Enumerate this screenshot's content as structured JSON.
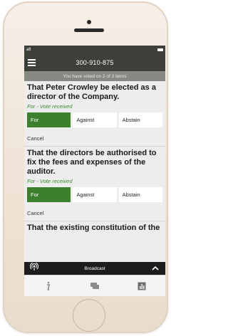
{
  "status_bar": {
    "signal": "atl"
  },
  "header": {
    "title": "300-910-875"
  },
  "banner": {
    "text": "You have voted on 2 of 3 items"
  },
  "resolutions": [
    {
      "title": "That Peter Crowley be elected as a director of the Company.",
      "status": "For - Vote received",
      "options": [
        "For",
        "Against",
        "Abstain"
      ],
      "selected": "For",
      "cancel_label": "Cancel"
    },
    {
      "title": "That the directors be authorised to fix the fees and expenses of the auditor.",
      "status": "For - Vote received",
      "options": [
        "For",
        "Against",
        "Abstain"
      ],
      "selected": "For",
      "cancel_label": "Cancel"
    },
    {
      "title": "That the existing constitution of the"
    }
  ],
  "broadcast": {
    "label": "Broadcast",
    "icon": "broadcast-icon"
  },
  "tabs": [
    {
      "name": "info",
      "icon": "info-icon"
    },
    {
      "name": "messages",
      "icon": "chat-icon"
    },
    {
      "name": "results",
      "icon": "bar-chart-icon"
    }
  ],
  "colors": {
    "header_bg": "#3d4038",
    "banner_bg": "#878a82",
    "selected_vote": "#3c7f2d",
    "status_text": "#3b8b2f",
    "broadcast_bg": "#1d1d1d",
    "phone_body": "#efe4d7"
  }
}
